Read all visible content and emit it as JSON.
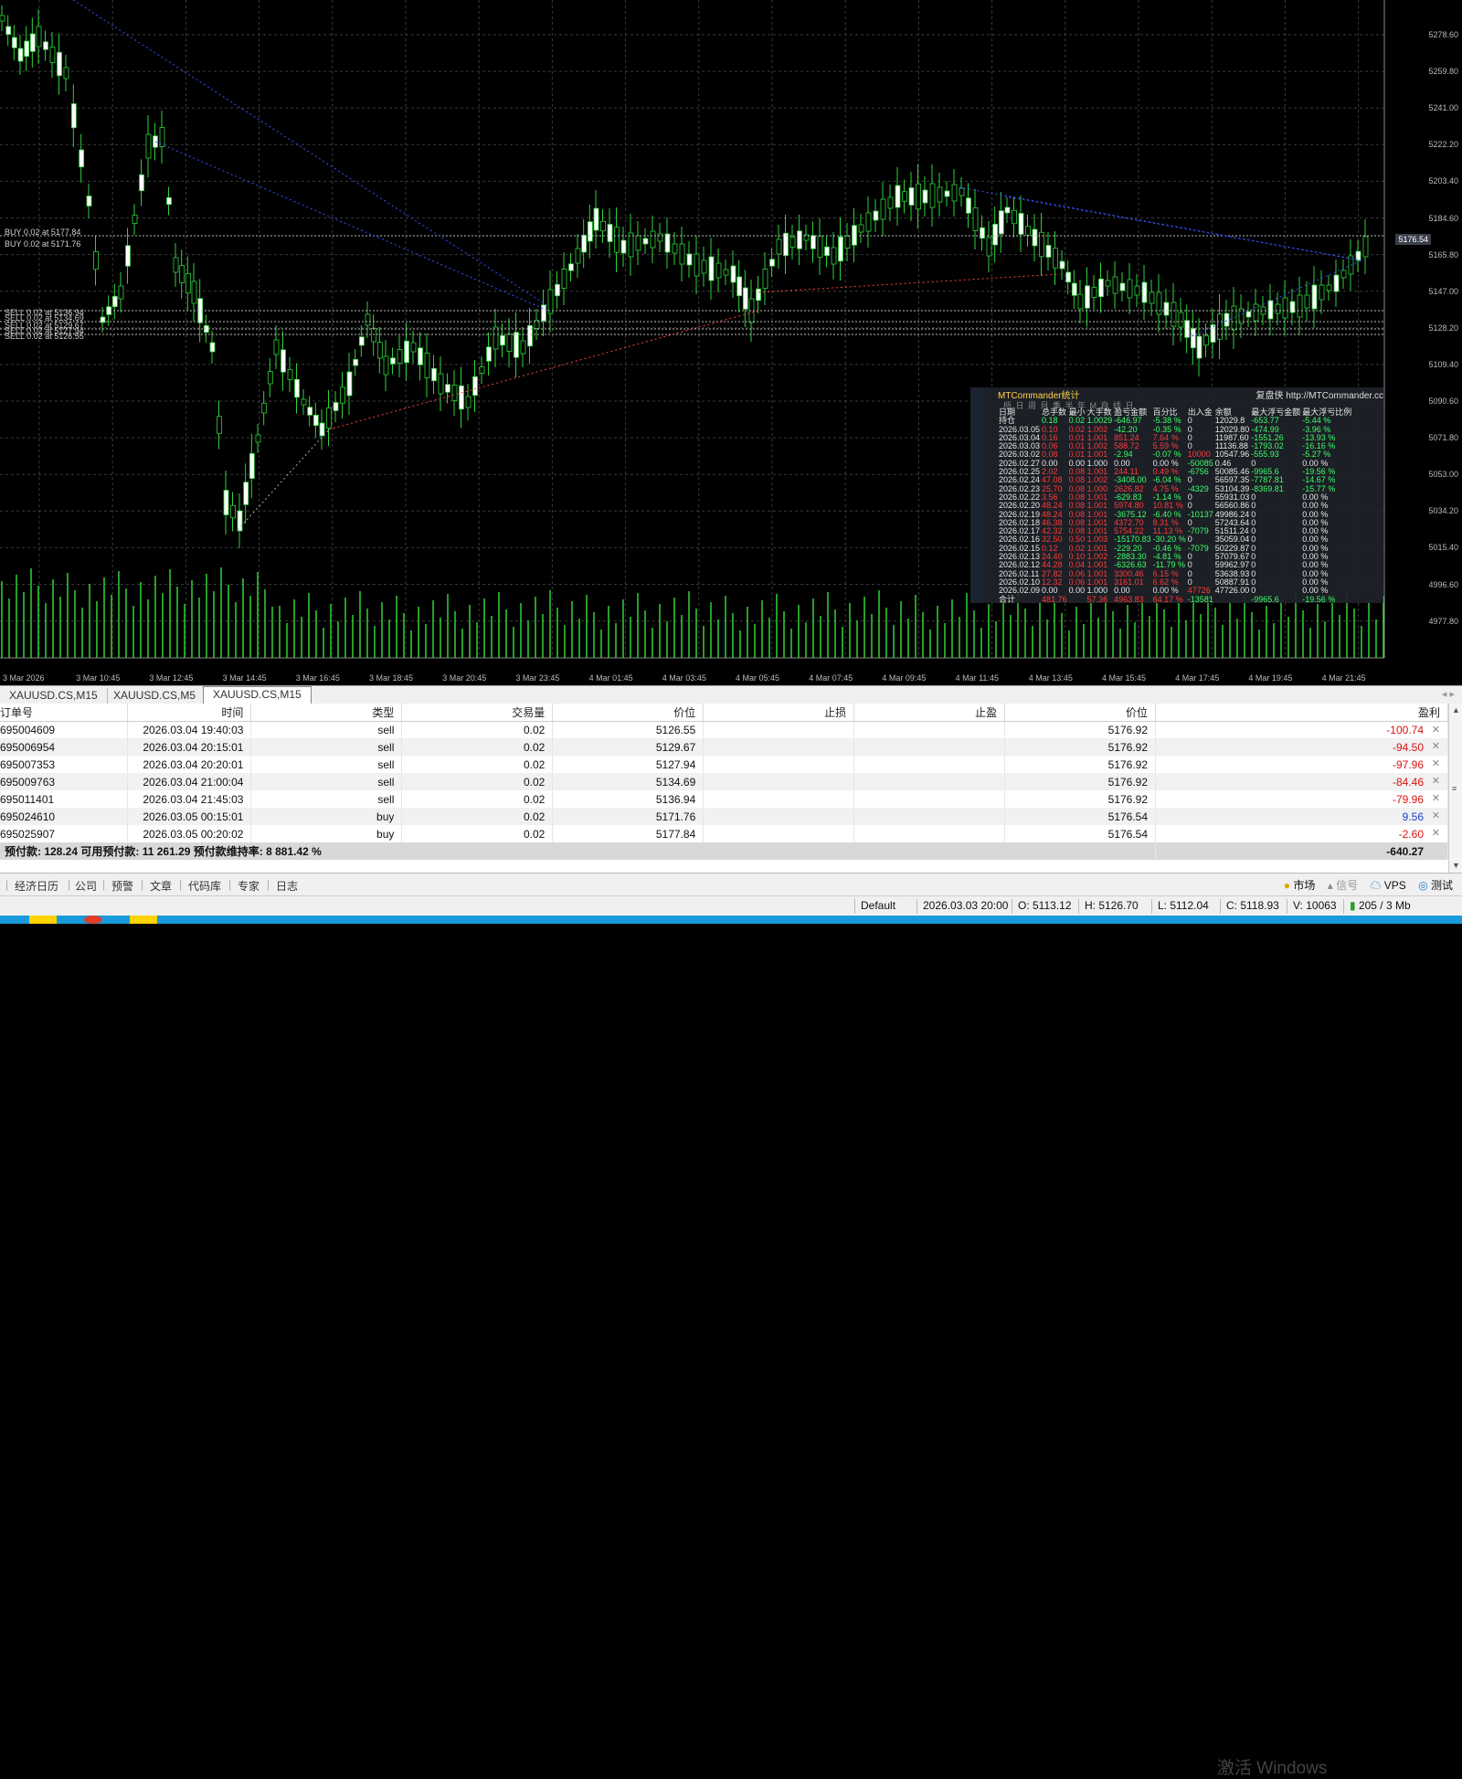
{
  "chart": {
    "price_labels": [
      "5278.60",
      "5259.80",
      "5241.00",
      "5222.20",
      "5203.40",
      "5184.60",
      "5165.80",
      "5147.00",
      "5128.20",
      "5109.40",
      "5090.60",
      "5071.80",
      "5053.00",
      "5034.20",
      "5015.40",
      "4996.60",
      "4977.80"
    ],
    "time_labels": [
      "3 Mar 2026",
      "3 Mar 10:45",
      "3 Mar 12:45",
      "3 Mar 14:45",
      "3 Mar 16:45",
      "3 Mar 18:45",
      "3 Mar 20:45",
      "3 Mar 23:45",
      "4 Mar 01:45",
      "4 Mar 03:45",
      "4 Mar 05:45",
      "4 Mar 07:45",
      "4 Mar 09:45",
      "4 Mar 11:45",
      "4 Mar 13:45",
      "4 Mar 15:45",
      "4 Mar 17:45",
      "4 Mar 19:45",
      "4 Mar 21:45"
    ],
    "current_price": "5176.54",
    "trade_tags": [
      "BUY 0.02 at 5177.84",
      "BUY 0.02 at 5171.76",
      "SELL 0.02 at 5136.94",
      "SELL 0.02 at 5134.69",
      "SELL 0.02 at 5129.67",
      "SELL 0.02 at 5127.94",
      "SELL 0.02 at 5126.55"
    ],
    "colors": {
      "bull": "#ffffff",
      "bear": "#ffffff",
      "grid": "#3a3a3a",
      "volume": "#35e23a",
      "buy_line": "#3355ff",
      "sell_line": "#ff4040"
    }
  },
  "stats": {
    "title": "MTCommander统计",
    "link": "复盘侠 http://MTCommander.cc",
    "tabs": "所 日 周 月 季 半 年 M 自 线 日",
    "version": "V 5.16",
    "headers": [
      "日期",
      "总手数",
      "最小",
      "大手数",
      "数",
      "盈亏金额",
      "百分比",
      "%",
      "出入金",
      "余额",
      "最大浮亏金额",
      "最大浮亏比例"
    ],
    "rows": [
      [
        "持仓",
        "0.18",
        "0.02",
        "1.0029",
        "-646.97",
        "-5.38 %",
        "0",
        "12029.8",
        "-653.77",
        "-5.44 %"
      ],
      [
        "2026.03.05",
        "0.10",
        "0.02",
        "1.002",
        "-42.20",
        "-0.35 %",
        "0",
        "12029.80",
        "-474.99",
        "-3.96 %"
      ],
      [
        "2026.03.04",
        "0.16",
        "0.01",
        "1.001",
        "851.24",
        "7.64 %",
        "0",
        "11987.60",
        "-1551.26",
        "-13.93 %"
      ],
      [
        "2026.03.03",
        "0.06",
        "0.01",
        "1.002",
        "588.72",
        "5.59 %",
        "0",
        "11136.88",
        "-1793.02",
        "-16.16 %"
      ],
      [
        "2026.03.02",
        "0.08",
        "0.01",
        "1.001",
        "-2.94",
        "-0.07 %",
        "10000",
        "10547.96",
        "-555.93",
        "-5.27 %"
      ],
      [
        "2026.02.27",
        "0.00",
        "0.00",
        "1.000",
        "0.00",
        "0.00 %",
        "-50085",
        "0.46",
        "0",
        "0.00 %"
      ],
      [
        "2026.02.25",
        "2.02",
        "0.08",
        "1.001",
        "244.11",
        "0.49 %",
        "-6756",
        "50085.46",
        "-9965.6",
        "-19.56 %"
      ],
      [
        "2026.02.24",
        "47.08",
        "0.08",
        "1.002",
        "-3408.00",
        "-6.04 %",
        "0",
        "56597.35",
        "-7787.81",
        "-14.67 %"
      ],
      [
        "2026.02.23",
        "25.70",
        "0.08",
        "1.000",
        "2626.82",
        "4.75 %",
        "-4329",
        "53104.39",
        "-8369.81",
        "-15.77 %"
      ],
      [
        "2026.02.22",
        "3.56",
        "0.08",
        "1.001",
        "-629.83",
        "-1.14 %",
        "0",
        "55931.03",
        "0",
        "0.00 %"
      ],
      [
        "2026.02.20",
        "48.24",
        "0.08",
        "1.001",
        "5974.80",
        "10.81 %",
        "0",
        "56560.86",
        "0",
        "0.00 %"
      ],
      [
        "2026.02.19",
        "48.24",
        "0.08",
        "1.001",
        "-3675.12",
        "-6.40 %",
        "-10137",
        "49986.24",
        "0",
        "0.00 %"
      ],
      [
        "2026.02.18",
        "46.38",
        "0.08",
        "1.001",
        "4372.70",
        "8.31 %",
        "0",
        "57243.64",
        "0",
        "0.00 %"
      ],
      [
        "2026.02.17",
        "42.32",
        "0.08",
        "1.001",
        "5754.22",
        "11.13 %",
        "-7079",
        "51511.24",
        "0",
        "0.00 %"
      ],
      [
        "2026.02.16",
        "32.50",
        "0.50",
        "1.003",
        "-15170.83",
        "-30.20 %",
        "0",
        "35059.04",
        "0",
        "0.00 %"
      ],
      [
        "2026.02.15",
        "0.12",
        "0.02",
        "1.001",
        "-229.20",
        "-0.46 %",
        "-7079",
        "50229.87",
        "0",
        "0.00 %"
      ],
      [
        "2026.02.13",
        "24.40",
        "0.10",
        "1.002",
        "-2883.30",
        "-4.81 %",
        "0",
        "57079.67",
        "0",
        "0.00 %"
      ],
      [
        "2026.02.12",
        "44.28",
        "0.04",
        "1.001",
        "-6326.63",
        "-11.79 %",
        "0",
        "59962.97",
        "0",
        "0.00 %"
      ],
      [
        "2026.02.11",
        "27.82",
        "0.06",
        "1.001",
        "3300.46",
        "6.15 %",
        "0",
        "53638.93",
        "0",
        "0.00 %"
      ],
      [
        "2026.02.10",
        "12.32",
        "0.06",
        "1.001",
        "3161.01",
        "6.62 %",
        "0",
        "50887.91",
        "0",
        "0.00 %"
      ],
      [
        "2026.02.09",
        "0.00",
        "0.00",
        "1.000",
        "0.00",
        "0.00 %",
        "47726",
        "47726.00",
        "0",
        "0.00 %"
      ]
    ],
    "total_row": [
      "合计",
      "481.76",
      "",
      "57.36",
      "4963.83",
      "64.17 %",
      "-13581",
      "",
      "-9965.6",
      "-19.56 %"
    ]
  },
  "symbol_tabs": [
    "XAUUSD.CS,M15",
    "XAUUSD.CS,M5",
    "XAUUSD.CS,M15"
  ],
  "trades": {
    "headers": [
      "订单号",
      "时间",
      "类型",
      "交易量",
      "价位",
      "止损",
      "止盈",
      "价位",
      "盈利"
    ],
    "rows": [
      [
        "695004609",
        "2026.03.04 19:40:03",
        "sell",
        "0.02",
        "5126.55",
        "",
        "",
        "5176.92",
        "-100.74"
      ],
      [
        "695006954",
        "2026.03.04 20:15:01",
        "sell",
        "0.02",
        "5129.67",
        "",
        "",
        "5176.92",
        "-94.50"
      ],
      [
        "695007353",
        "2026.03.04 20:20:01",
        "sell",
        "0.02",
        "5127.94",
        "",
        "",
        "5176.92",
        "-97.96"
      ],
      [
        "695009763",
        "2026.03.04 21:00:04",
        "sell",
        "0.02",
        "5134.69",
        "",
        "",
        "5176.92",
        "-84.46"
      ],
      [
        "695011401",
        "2026.03.04 21:45:03",
        "sell",
        "0.02",
        "5136.94",
        "",
        "",
        "5176.92",
        "-79.96"
      ],
      [
        "695024610",
        "2026.03.05 00:15:01",
        "buy",
        "0.02",
        "5171.76",
        "",
        "",
        "5176.54",
        "9.56"
      ],
      [
        "695025907",
        "2026.03.05 00:20:02",
        "buy",
        "0.02",
        "5177.84",
        "",
        "",
        "5176.54",
        "-2.60"
      ]
    ],
    "summary": "预付款: 128.24  可用预付款: 11 261.29  预付款维持率: 8 881.42 %",
    "summary_total": "-640.27"
  },
  "bottom_tabs": [
    "经济日历",
    "公司",
    "预警",
    "文章",
    "代码库",
    "专家",
    "日志"
  ],
  "right_tools": {
    "market": "市场",
    "signals": "信号",
    "vps": "VPS",
    "test": "测试"
  },
  "watermark": "激活 Windows",
  "status": {
    "profile": "Default",
    "datetime": "2026.03.03 20:00",
    "open": "O: 5113.12",
    "high": "H: 5126.70",
    "low": "L: 5112.04",
    "close": "C: 5118.93",
    "volume": "V: 10063",
    "traffic": "205 / 3 Mb"
  }
}
